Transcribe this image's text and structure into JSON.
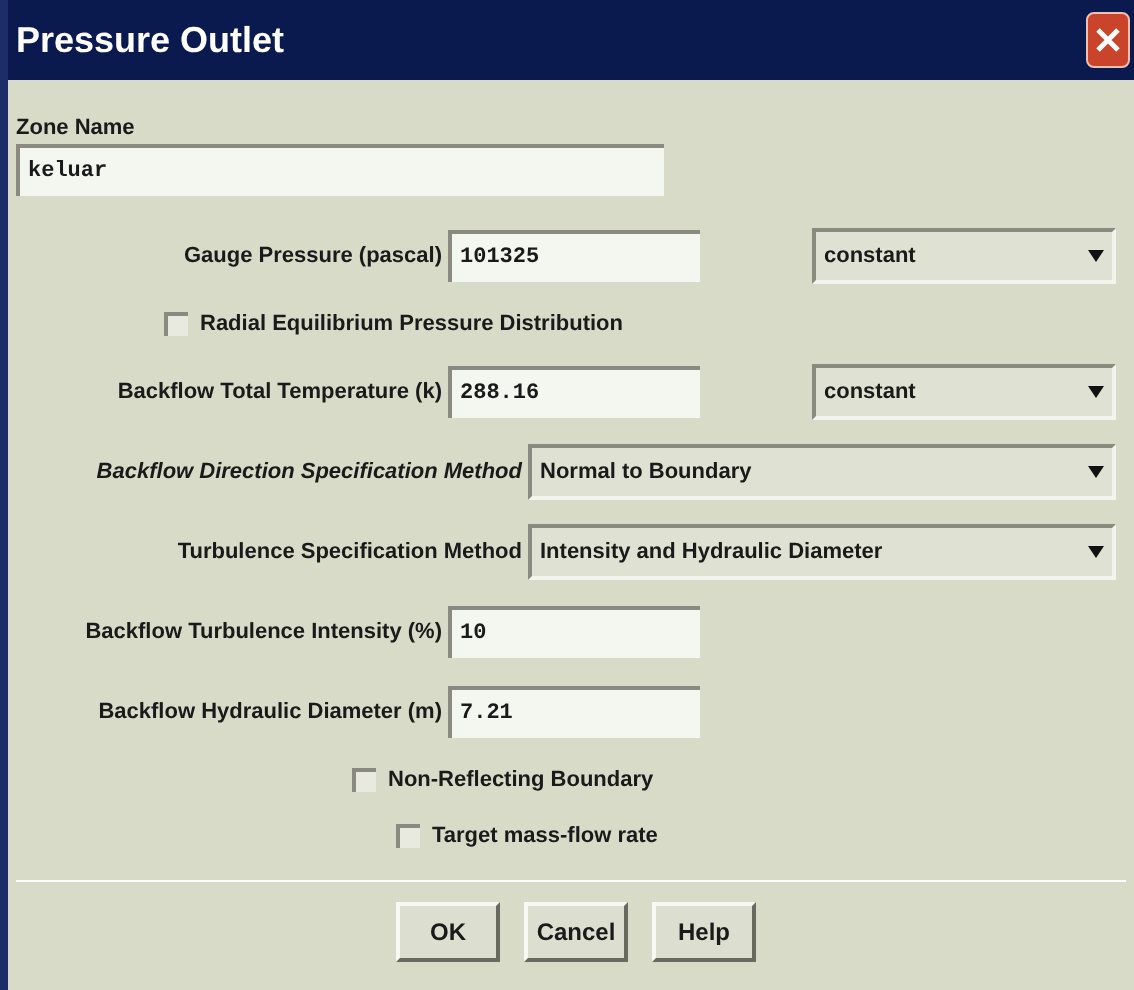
{
  "window": {
    "title": "Pressure Outlet"
  },
  "zone_name": {
    "label": "Zone Name",
    "value": "keluar"
  },
  "rows": [
    {
      "kind": "input",
      "label": "Gauge Pressure (pascal)",
      "value": "101325",
      "option": "constant"
    },
    {
      "kind": "checkbox",
      "label": "Radial Equilibrium Pressure Distribution",
      "checked": false
    },
    {
      "kind": "input",
      "label": "Backflow Total Temperature (k)",
      "value": "288.16",
      "option": "constant"
    },
    {
      "kind": "select",
      "label": "Backflow Direction Specification Method",
      "value": "Normal to Boundary",
      "italic": true
    },
    {
      "kind": "select",
      "label": "Turbulence Specification Method",
      "value": "Intensity and Hydraulic Diameter",
      "italic": false
    },
    {
      "kind": "input",
      "label": "Backflow Turbulence Intensity (%)",
      "value": "10"
    },
    {
      "kind": "input",
      "label": "Backflow Hydraulic Diameter (m)",
      "value": "7.21"
    },
    {
      "kind": "checkbox",
      "label": "Non-Reflecting Boundary",
      "checked": false
    },
    {
      "kind": "checkbox",
      "label": "Target mass-flow rate",
      "checked": false
    }
  ],
  "buttons": [
    "OK",
    "Cancel",
    "Help"
  ]
}
